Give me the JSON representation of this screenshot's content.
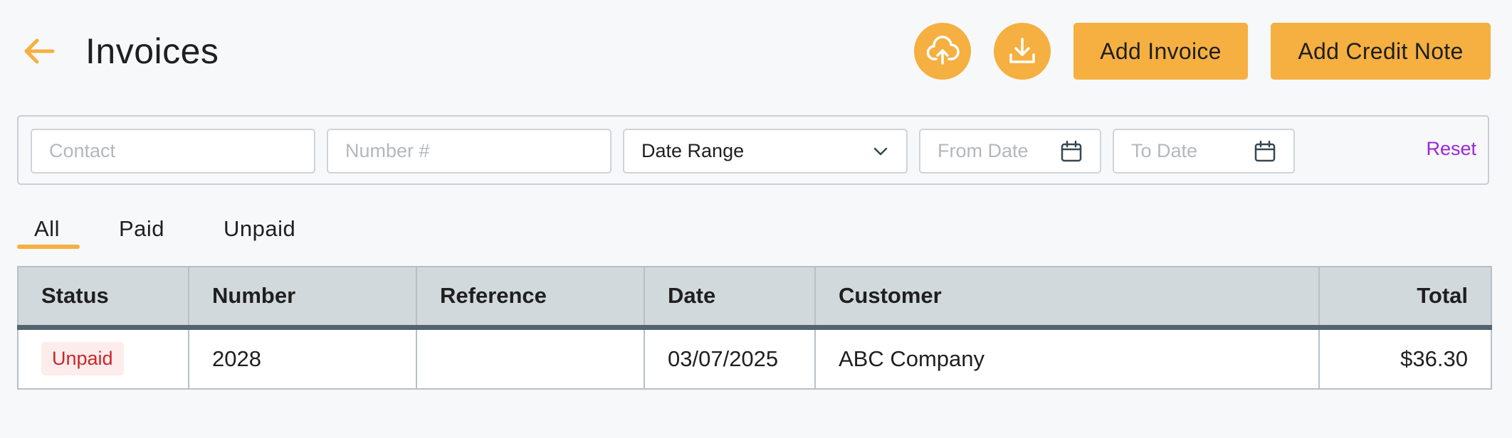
{
  "header": {
    "title": "Invoices",
    "add_invoice_label": "Add Invoice",
    "add_credit_note_label": "Add Credit Note"
  },
  "filters": {
    "contact_placeholder": "Contact",
    "number_placeholder": "Number #",
    "date_range_value": "Date Range",
    "from_date_placeholder": "From Date",
    "to_date_placeholder": "To Date",
    "reset_label": "Reset"
  },
  "tabs": [
    "All",
    "Paid",
    "Unpaid"
  ],
  "active_tab": "All",
  "table": {
    "columns": [
      "Status",
      "Number",
      "Reference",
      "Date",
      "Customer",
      "Total"
    ],
    "rows": [
      {
        "status": "Unpaid",
        "number": "2028",
        "reference": "",
        "date": "03/07/2025",
        "customer": "ABC Company",
        "total": "$36.30"
      }
    ]
  },
  "icons": {
    "back": "arrow-left-icon",
    "upload": "cloud-upload-icon",
    "download": "download-icon",
    "date_range": "chevron-down-icon",
    "calendar": "calendar-icon"
  },
  "colors": {
    "accent": "#f5b041",
    "reset_link": "#9b27d6",
    "unpaid_text": "#c62828",
    "unpaid_bg": "#fdecec",
    "table_header_bg": "#d2d9dd"
  }
}
